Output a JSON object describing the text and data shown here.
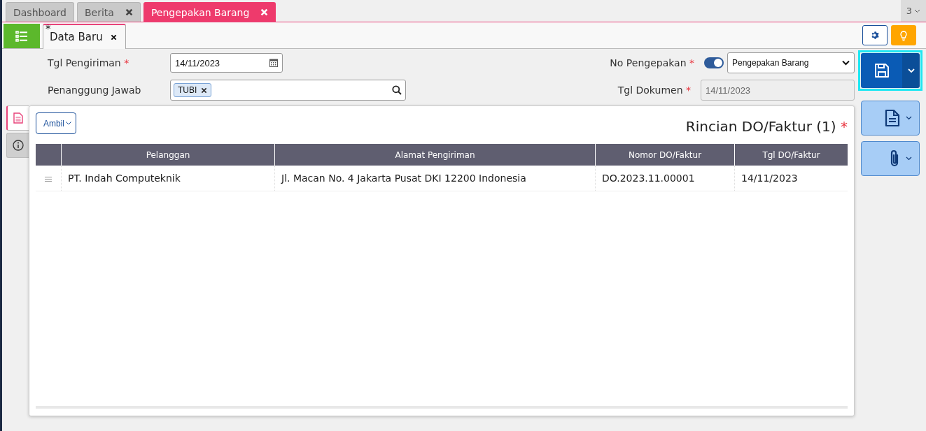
{
  "top_tabs": [
    {
      "label": "Dashboard",
      "selected": false,
      "closable": false
    },
    {
      "label": "Berita",
      "selected": false,
      "closable": true
    },
    {
      "label": "Pengepakan Barang",
      "selected": true,
      "closable": true
    }
  ],
  "tab_count": "3",
  "doc_tab": {
    "label": "Data Baru",
    "modified_mark": "*"
  },
  "form": {
    "tgl_pengiriman": {
      "label": "Tgl Pengiriman",
      "required_mark": "*",
      "value": "14/11/2023"
    },
    "penanggung_jawab": {
      "label": "Penanggung Jawab",
      "tags": [
        "TUBI"
      ]
    },
    "no_pengepakan": {
      "label": "No Pengepakan",
      "required_mark": "*",
      "toggle_on": true,
      "value": "Pengepakan Barang"
    },
    "tgl_dokumen": {
      "label": "Tgl Dokumen",
      "required_mark": "*",
      "value": "14/11/2023",
      "disabled": true
    }
  },
  "side_tabs": [
    {
      "kind": "document",
      "selected": true
    },
    {
      "kind": "info",
      "selected": false
    }
  ],
  "ambil_button": "Ambil",
  "section_title": "Rincian DO/Faktur (1)",
  "section_required_mark": "*",
  "table": {
    "columns": [
      "Pelanggan",
      "Alamat Pengiriman",
      "Nomor DO/Faktur",
      "Tgl DO/Faktur"
    ],
    "rows": [
      [
        "PT. Indah Computeknik",
        "Jl. Macan No. 4 Jakarta Pusat DKI 12200 Indonesia",
        "DO.2023.11.00001",
        "14/11/2023"
      ]
    ]
  }
}
